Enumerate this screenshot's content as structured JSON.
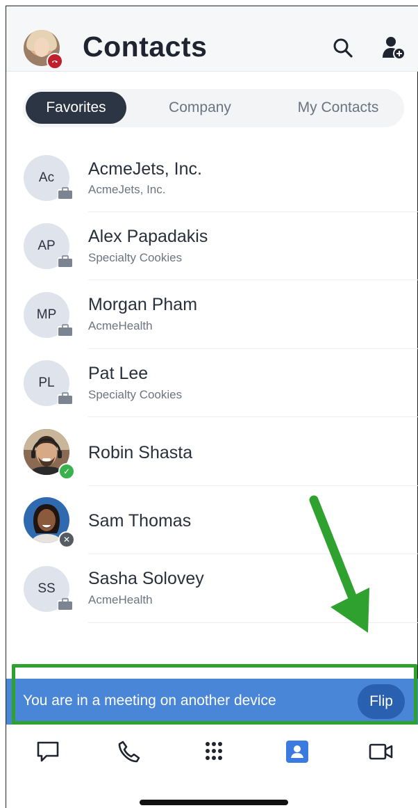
{
  "header": {
    "title": "Contacts",
    "search_icon": "search-icon",
    "add_contact_icon": "add-contact-icon",
    "user_status": "busy"
  },
  "tabs": [
    {
      "label": "Favorites",
      "active": true
    },
    {
      "label": "Company",
      "active": false
    },
    {
      "label": "My Contacts",
      "active": false
    }
  ],
  "contacts": [
    {
      "initials": "Ac",
      "name": "AcmeJets, Inc.",
      "company": "AcmeJets, Inc.",
      "type": "company-contact"
    },
    {
      "initials": "AP",
      "name": "Alex Papadakis",
      "company": "Specialty Cookies",
      "type": "company-contact"
    },
    {
      "initials": "MP",
      "name": "Morgan Pham",
      "company": "AcmeHealth",
      "type": "company-contact"
    },
    {
      "initials": "PL",
      "name": "Pat Lee",
      "company": "Specialty Cookies",
      "type": "company-contact"
    },
    {
      "initials": "",
      "name": "Robin Shasta",
      "company": "",
      "type": "photo",
      "status": "available"
    },
    {
      "initials": "",
      "name": "Sam Thomas",
      "company": "",
      "type": "photo",
      "status": "offline"
    },
    {
      "initials": "SS",
      "name": "Sasha Solovey",
      "company": "AcmeHealth",
      "type": "company-contact"
    }
  ],
  "banner": {
    "text": "You are in a meeting on another device",
    "flip_label": "Flip"
  },
  "bottom_nav": [
    {
      "icon": "chat-icon",
      "active": false
    },
    {
      "icon": "phone-icon",
      "active": false
    },
    {
      "icon": "dialpad-icon",
      "active": false
    },
    {
      "icon": "contacts-icon",
      "active": true
    },
    {
      "icon": "video-icon",
      "active": false
    }
  ],
  "colors": {
    "accent": "#2c3543",
    "banner": "#4a86d8",
    "flip": "#2a60b0",
    "annotation": "#2ea12e",
    "nav_active": "#3b7be0"
  }
}
